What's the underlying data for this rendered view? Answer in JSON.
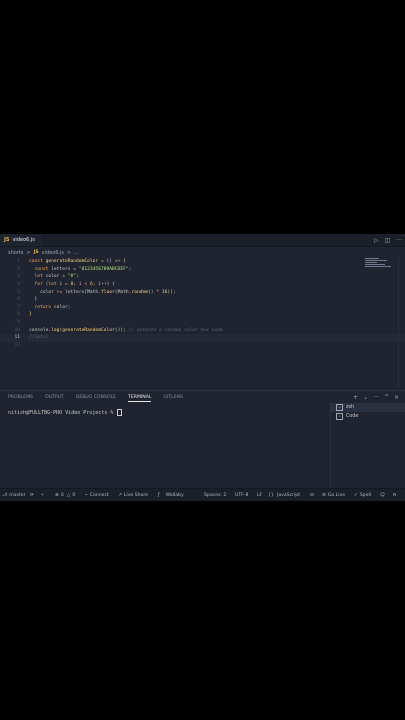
{
  "tab": {
    "icon_text": "JS",
    "filename": "video6.js"
  },
  "tab_actions": {
    "run_icon": "play-icon",
    "split_icon": "split-editor-icon",
    "more_icon": "more-icon"
  },
  "breadcrumb": {
    "folder": "shorts",
    "sep": ">",
    "file_icon_text": "JS",
    "file": "video6.js",
    "sep2": ">",
    "more": "..."
  },
  "editor": {
    "current_line": 11,
    "lines": [
      {
        "n": "1",
        "tokens": [
          [
            "kw",
            "const "
          ],
          [
            "fn",
            "generateRandomColor"
          ],
          [
            "op",
            " = "
          ],
          [
            "brk",
            "() "
          ],
          [
            "op",
            "=>"
          ],
          [
            "brk",
            " {"
          ]
        ]
      },
      {
        "n": "2",
        "tokens": [
          [
            "kw",
            "  const "
          ],
          [
            "code",
            "letters "
          ],
          [
            "op",
            "= "
          ],
          [
            "str",
            "\"0123456789ABCDEF\""
          ],
          [
            "code",
            ";"
          ]
        ]
      },
      {
        "n": "3",
        "tokens": [
          [
            "kw",
            "  let "
          ],
          [
            "code",
            "color "
          ],
          [
            "op",
            "= "
          ],
          [
            "str",
            "\"#\""
          ],
          [
            "code",
            ";"
          ]
        ]
      },
      {
        "n": "4",
        "tokens": [
          [
            "kw",
            "  for "
          ],
          [
            "brk",
            "("
          ],
          [
            "kw",
            "let "
          ],
          [
            "code",
            "i "
          ],
          [
            "op",
            "= "
          ],
          [
            "num",
            "0"
          ],
          [
            "code",
            "; i "
          ],
          [
            "op",
            "< "
          ],
          [
            "num",
            "6"
          ],
          [
            "code",
            "; i"
          ],
          [
            "op",
            "++"
          ],
          [
            "brk",
            ") {"
          ]
        ]
      },
      {
        "n": "5",
        "tokens": [
          [
            "code",
            "    color "
          ],
          [
            "op",
            "+= "
          ],
          [
            "code",
            "letters[Math."
          ],
          [
            "fn",
            "floor"
          ],
          [
            "code",
            "(Math."
          ],
          [
            "fn",
            "random"
          ],
          [
            "code",
            "() "
          ],
          [
            "op",
            "* "
          ],
          [
            "num",
            "16"
          ],
          [
            "code",
            ")];"
          ]
        ]
      },
      {
        "n": "6",
        "tokens": [
          [
            "brk",
            "  }"
          ]
        ]
      },
      {
        "n": "7",
        "tokens": [
          [
            "kw",
            "  return "
          ],
          [
            "code",
            "color;"
          ]
        ]
      },
      {
        "n": "8",
        "tokens": [
          [
            "fn",
            "}"
          ]
        ]
      },
      {
        "n": "9",
        "tokens": []
      },
      {
        "n": "10",
        "tokens": [
          [
            "code",
            "console."
          ],
          [
            "fn",
            "log"
          ],
          [
            "code",
            "("
          ],
          [
            "fn",
            "generateRandomColor"
          ],
          [
            "code",
            "()); "
          ],
          [
            "cm",
            "// outputs a random color hex code"
          ]
        ]
      },
      {
        "n": "11",
        "tokens": [
          [
            "cm",
            "//lets|"
          ]
        ]
      },
      {
        "n": "12",
        "tokens": []
      }
    ]
  },
  "panel": {
    "tabs": [
      "PROBLEMS",
      "OUTPUT",
      "DEBUG CONSOLE",
      "TERMINAL",
      "GITLENS"
    ],
    "active_tab": "TERMINAL",
    "actions": [
      "+",
      "⌄",
      "···",
      "^",
      "×"
    ],
    "prompt": "nitish@FULLTBG-PRO Video Projects % ",
    "terminals": [
      "zsh",
      "Code"
    ],
    "selected_terminal": "zsh"
  },
  "status": {
    "branch": "master",
    "errors": "0",
    "warnings": "0",
    "connect": "Connect",
    "liveshare": "Live Share",
    "wallaby": "Wallaby",
    "spaces": "Spaces: 2",
    "encoding": "UTF-8",
    "eol": "LF",
    "language": "JavaScript",
    "golive": "Go Live",
    "spell": "Spell"
  }
}
